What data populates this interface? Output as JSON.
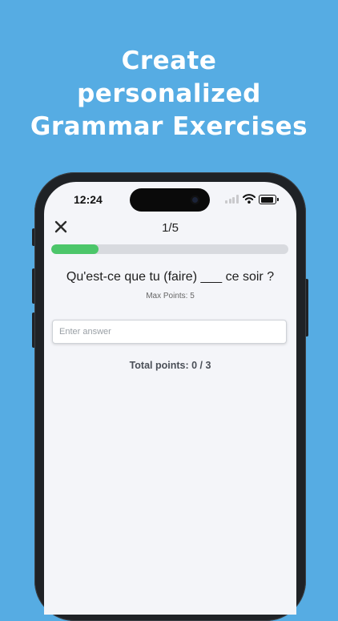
{
  "marketing": {
    "headline_line1": "Create",
    "headline_line2": "personalized",
    "headline_line3": "Grammar Exercises",
    "background_color": "#56ace3"
  },
  "status_bar": {
    "time": "12:24",
    "icons": [
      "signal-icon",
      "wifi-icon",
      "battery-icon"
    ]
  },
  "quiz": {
    "close_icon": "close-icon",
    "counter": "1/5",
    "progress": 0.2,
    "progress_color": "#4cc66a",
    "question": "Qu'est-ce que tu (faire) ___ ce soir ?",
    "max_points": "Max Points: 5",
    "answer_placeholder": "Enter answer",
    "answer_value": "",
    "total_points": "Total points: 0 / 3"
  }
}
